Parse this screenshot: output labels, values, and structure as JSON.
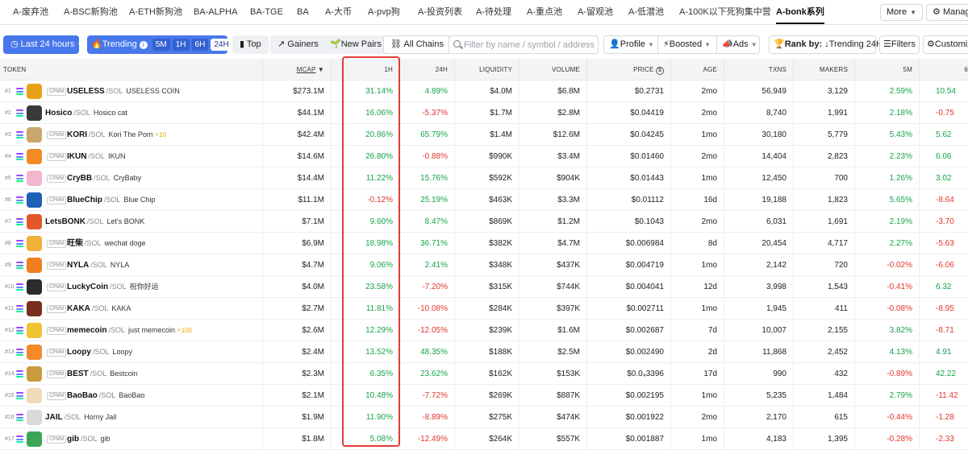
{
  "tabs": [
    "A-废弃池",
    "A-BSC新狗池",
    "A-ETH新狗池",
    "BA-ALPHA",
    "BA-TGE",
    "BA",
    "A-大币",
    "A-pvp狗",
    "A-投资列表",
    "A-待处理",
    "A-重点池",
    "A-留观池",
    "A-低潜池",
    "A-100K以下死狗集中营",
    "A-bonk系列"
  ],
  "active_tab_index": 14,
  "toolbar": {
    "more_label": "More",
    "manage_label": "Manag"
  },
  "filters": {
    "time_label": "Last 24 hours",
    "trending_label": "Trending",
    "timeframes": [
      "5M",
      "1H",
      "6H",
      "24H"
    ],
    "selected_timeframe": "24H",
    "top_label": "Top",
    "gainers_label": "Gainers",
    "new_pairs_label": "New Pairs",
    "all_chains_label": "All Chains",
    "search_placeholder": "Filter by name / symbol / address",
    "profile_label": "Profile",
    "boosted_label": "Boosted",
    "ads_label": "Ads",
    "rank_by_label": "Rank by:",
    "rank_by_value": "Trending 24H",
    "filters_label": "Filters",
    "customize_label": "Customiz"
  },
  "columns": {
    "token": "TOKEN",
    "mcap": "MCAP",
    "h1": "1H",
    "h24": "24H",
    "liquidity": "LIQUIDITY",
    "volume": "VOLUME",
    "price": "PRICE",
    "age": "AGE",
    "txns": "TXNS",
    "makers": "MAKERS",
    "m5": "5M",
    "h6": "6"
  },
  "colors": {
    "positive": "#17a34a",
    "negative": "#e0352b",
    "accent": "#4778ec",
    "highlight": "#e43b34"
  },
  "pair_suffix": "/SOL",
  "pool_tag": "CPMM",
  "rows": [
    {
      "rank": "#1",
      "symbol": "USELESS",
      "name": "USELESS COIN",
      "boost": "",
      "mcap": "$273.1M",
      "h1": "31.14%",
      "h24": "4.89%",
      "liquidity": "$4.0M",
      "volume": "$6.8M",
      "price": "$0.2731",
      "age": "2mo",
      "txns": "56,949",
      "makers": "3,129",
      "m5": "2.59%",
      "h6": "10.54",
      "avatar": "#e8a21a",
      "cpmm": true
    },
    {
      "rank": "#2",
      "symbol": "Hosico",
      "name": "Hosico cat",
      "boost": "",
      "mcap": "$44.1M",
      "h1": "16.06%",
      "h24": "-5.37%",
      "liquidity": "$1.7M",
      "volume": "$2.8M",
      "price": "$0.04419",
      "age": "2mo",
      "txns": "8,740",
      "makers": "1,991",
      "m5": "2.18%",
      "h6": "-0.75",
      "avatar": "#3a3a3a",
      "cpmm": false
    },
    {
      "rank": "#3",
      "symbol": "KORI",
      "name": "Kori The Pom",
      "boost": "⚡10",
      "mcap": "$42.4M",
      "h1": "20.86%",
      "h24": "65.79%",
      "liquidity": "$1.4M",
      "volume": "$12.6M",
      "price": "$0.04245",
      "age": "1mo",
      "txns": "30,180",
      "makers": "5,779",
      "m5": "5.43%",
      "h6": "5.62",
      "avatar": "#c9a66b",
      "cpmm": true
    },
    {
      "rank": "#4",
      "symbol": "IKUN",
      "name": "IKUN",
      "boost": "",
      "mcap": "$14.6M",
      "h1": "26.80%",
      "h24": "-0.88%",
      "liquidity": "$990K",
      "volume": "$3.4M",
      "price": "$0.01460",
      "age": "2mo",
      "txns": "14,404",
      "makers": "2,823",
      "m5": "2.23%",
      "h6": "6.06",
      "avatar": "#f28b24",
      "cpmm": true
    },
    {
      "rank": "#5",
      "symbol": "CryBB",
      "name": "CryBaby",
      "boost": "",
      "mcap": "$14.4M",
      "h1": "11.22%",
      "h24": "15.76%",
      "liquidity": "$592K",
      "volume": "$904K",
      "price": "$0.01443",
      "age": "1mo",
      "txns": "12,450",
      "makers": "700",
      "m5": "1.26%",
      "h6": "3.02",
      "avatar": "#f3b5cf",
      "cpmm": true
    },
    {
      "rank": "#6",
      "symbol": "BlueChip",
      "name": "Blue Chip",
      "boost": "",
      "mcap": "$11.1M",
      "h1": "-0.12%",
      "h24": "25.19%",
      "liquidity": "$463K",
      "volume": "$3.3M",
      "price": "$0.01112",
      "age": "16d",
      "txns": "19,188",
      "makers": "1,823",
      "m5": "5.65%",
      "h6": "-8.64",
      "avatar": "#1f5fb8",
      "cpmm": true
    },
    {
      "rank": "#7",
      "symbol": "LetsBONK",
      "name": "Let's BONK",
      "boost": "",
      "mcap": "$7.1M",
      "h1": "9.60%",
      "h24": "8.47%",
      "liquidity": "$869K",
      "volume": "$1.2M",
      "price": "$0.1043",
      "age": "2mo",
      "txns": "6,031",
      "makers": "1,691",
      "m5": "2.19%",
      "h6": "-3.70",
      "avatar": "#e2572b",
      "cpmm": false
    },
    {
      "rank": "#8",
      "symbol": "旺柴",
      "name": "wechat doge",
      "boost": "",
      "mcap": "$6.9M",
      "h1": "18.98%",
      "h24": "36.71%",
      "liquidity": "$382K",
      "volume": "$4.7M",
      "price": "$0.006984",
      "age": "8d",
      "txns": "20,454",
      "makers": "4,717",
      "m5": "2.27%",
      "h6": "-5.63",
      "avatar": "#f0b03a",
      "cpmm": true
    },
    {
      "rank": "#9",
      "symbol": "NYLA",
      "name": "NYLA",
      "boost": "",
      "mcap": "$4.7M",
      "h1": "9.06%",
      "h24": "2.41%",
      "liquidity": "$348K",
      "volume": "$437K",
      "price": "$0.004719",
      "age": "1mo",
      "txns": "2,142",
      "makers": "720",
      "m5": "-0.02%",
      "h6": "-6.06",
      "avatar": "#f07d1e",
      "cpmm": true
    },
    {
      "rank": "#10",
      "symbol": "LuckyCoin",
      "name": "祝你好运",
      "boost": "",
      "mcap": "$4.0M",
      "h1": "23.58%",
      "h24": "-7.20%",
      "liquidity": "$315K",
      "volume": "$744K",
      "price": "$0.004041",
      "age": "12d",
      "txns": "3,998",
      "makers": "1,543",
      "m5": "-0.41%",
      "h6": "6.32",
      "avatar": "#2b2b2b",
      "cpmm": true
    },
    {
      "rank": "#11",
      "symbol": "KAKA",
      "name": "KAKA",
      "boost": "",
      "mcap": "$2.7M",
      "h1": "11.81%",
      "h24": "-10.08%",
      "liquidity": "$284K",
      "volume": "$397K",
      "price": "$0.002711",
      "age": "1mo",
      "txns": "1,945",
      "makers": "411",
      "m5": "-0.08%",
      "h6": "-8.95",
      "avatar": "#7a2e1d",
      "cpmm": true
    },
    {
      "rank": "#12",
      "symbol": "memecoin",
      "name": "just memecoin",
      "boost": "⚡100",
      "mcap": "$2.6M",
      "h1": "12.29%",
      "h24": "-12.05%",
      "liquidity": "$239K",
      "volume": "$1.6M",
      "price": "$0.002687",
      "age": "7d",
      "txns": "10,007",
      "makers": "2,155",
      "m5": "3.82%",
      "h6": "-8.71",
      "avatar": "#f1c232",
      "cpmm": true
    },
    {
      "rank": "#13",
      "symbol": "Loopy",
      "name": "Loopy",
      "boost": "",
      "mcap": "$2.4M",
      "h1": "13.52%",
      "h24": "48.35%",
      "liquidity": "$188K",
      "volume": "$2.5M",
      "price": "$0.002490",
      "age": "2d",
      "txns": "11,868",
      "makers": "2,452",
      "m5": "4.13%",
      "h6": "4.91",
      "avatar": "#f58a2a",
      "cpmm": true
    },
    {
      "rank": "#14",
      "symbol": "BEST",
      "name": "Bestcoin",
      "boost": "",
      "mcap": "$2.3M",
      "h1": "6.35%",
      "h24": "23.62%",
      "liquidity": "$162K",
      "volume": "$153K",
      "price": "$0.0₄3396",
      "age": "17d",
      "txns": "990",
      "makers": "432",
      "m5": "-0.89%",
      "h6": "42.22",
      "avatar": "#c89b3c",
      "cpmm": true
    },
    {
      "rank": "#15",
      "symbol": "BaoBao",
      "name": "BaoBao",
      "boost": "",
      "mcap": "$2.1M",
      "h1": "10.48%",
      "h24": "-7.72%",
      "liquidity": "$269K",
      "volume": "$887K",
      "price": "$0.002195",
      "age": "1mo",
      "txns": "5,235",
      "makers": "1,484",
      "m5": "2.79%",
      "h6": "-11.42",
      "avatar": "#f0d9b5",
      "cpmm": true
    },
    {
      "rank": "#16",
      "symbol": "JAIL",
      "name": "Horny Jail",
      "boost": "",
      "mcap": "$1.9M",
      "h1": "11.90%",
      "h24": "-8.89%",
      "liquidity": "$275K",
      "volume": "$474K",
      "price": "$0.001922",
      "age": "2mo",
      "txns": "2,170",
      "makers": "615",
      "m5": "-0.44%",
      "h6": "-1.28",
      "avatar": "#d9d9d9",
      "cpmm": false
    },
    {
      "rank": "#17",
      "symbol": "gib",
      "name": "gib",
      "boost": "",
      "mcap": "$1.8M",
      "h1": "5.08%",
      "h24": "-12.49%",
      "liquidity": "$264K",
      "volume": "$557K",
      "price": "$0.001887",
      "age": "1mo",
      "txns": "4,183",
      "makers": "1,395",
      "m5": "-0.28%",
      "h6": "-2.33",
      "avatar": "#3aa655",
      "cpmm": true
    }
  ]
}
